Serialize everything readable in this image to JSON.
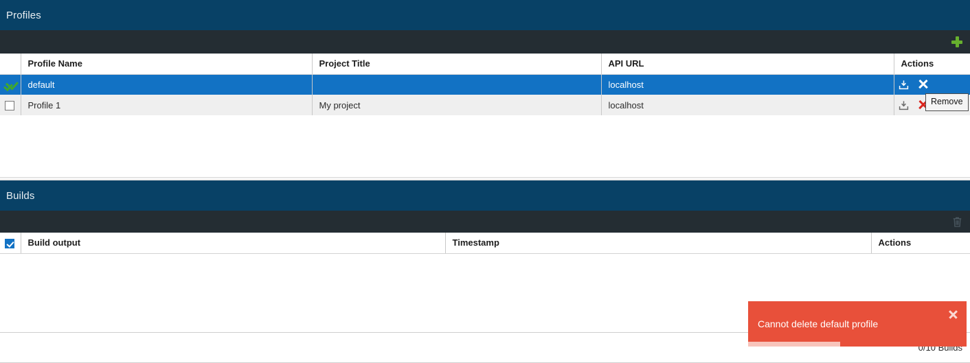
{
  "profiles": {
    "title": "Profiles",
    "toolbar": {
      "add_icon": "plus-icon"
    },
    "columns": [
      "",
      "Profile Name",
      "Project Title",
      "API URL",
      "Actions"
    ],
    "rows": [
      {
        "selected_icon": "check-mark-icon",
        "name": "default",
        "project_title": "",
        "api_url": "localhost",
        "actions": [
          "export-icon",
          "remove-icon"
        ],
        "selected": true
      },
      {
        "selected_icon": "checkbox-unchecked-icon",
        "name": "Profile 1",
        "project_title": "My project",
        "api_url": "localhost",
        "actions": [
          "export-icon",
          "remove-icon"
        ],
        "selected": false
      }
    ],
    "tooltip": "Remove"
  },
  "builds": {
    "title": "Builds",
    "toolbar": {
      "delete_icon": "trash-icon"
    },
    "columns": [
      "",
      "Build output",
      "Timestamp",
      "Actions"
    ],
    "header_checkbox_checked": true,
    "rows": []
  },
  "status_bar": {
    "builds_count": "0/10 Builds"
  },
  "toast": {
    "message": "Cannot delete default profile",
    "close_icon": "close-icon",
    "progress_percent": 42,
    "background_color": "#e8503a"
  },
  "colors": {
    "panel_title_bg": "#084166",
    "toolbar_bg": "#242d33",
    "row_selected_bg": "#1272c4",
    "row_alt_bg": "#efefef",
    "add_icon": "#67b02e",
    "remove_icon": "#d9251d",
    "toast_bg": "#e8503a"
  }
}
